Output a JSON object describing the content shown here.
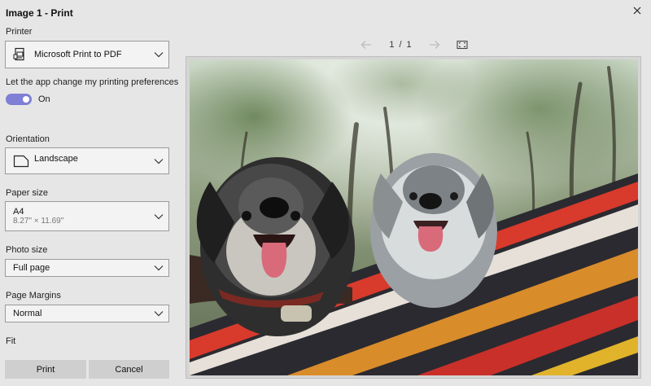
{
  "window": {
    "title": "Image 1 - Print"
  },
  "printer": {
    "label": "Printer",
    "value": "Microsoft Print to PDF",
    "icon": "printer-icon"
  },
  "preferences": {
    "label": "Let the app change my printing preferences",
    "toggle_state": "On",
    "accent": "#7f7fd5"
  },
  "orientation": {
    "label": "Orientation",
    "value": "Landscape",
    "icon": "page-landscape-icon"
  },
  "paper_size": {
    "label": "Paper size",
    "value": "A4",
    "detail": "8.27\" × 11.69\""
  },
  "photo_size": {
    "label": "Photo size",
    "value": "Full page"
  },
  "page_margins": {
    "label": "Page Margins",
    "value": "Normal"
  },
  "fit": {
    "label": "Fit"
  },
  "actions": {
    "print": "Print",
    "cancel": "Cancel"
  },
  "pager": {
    "current": "1",
    "separator": "/",
    "total": "1"
  }
}
